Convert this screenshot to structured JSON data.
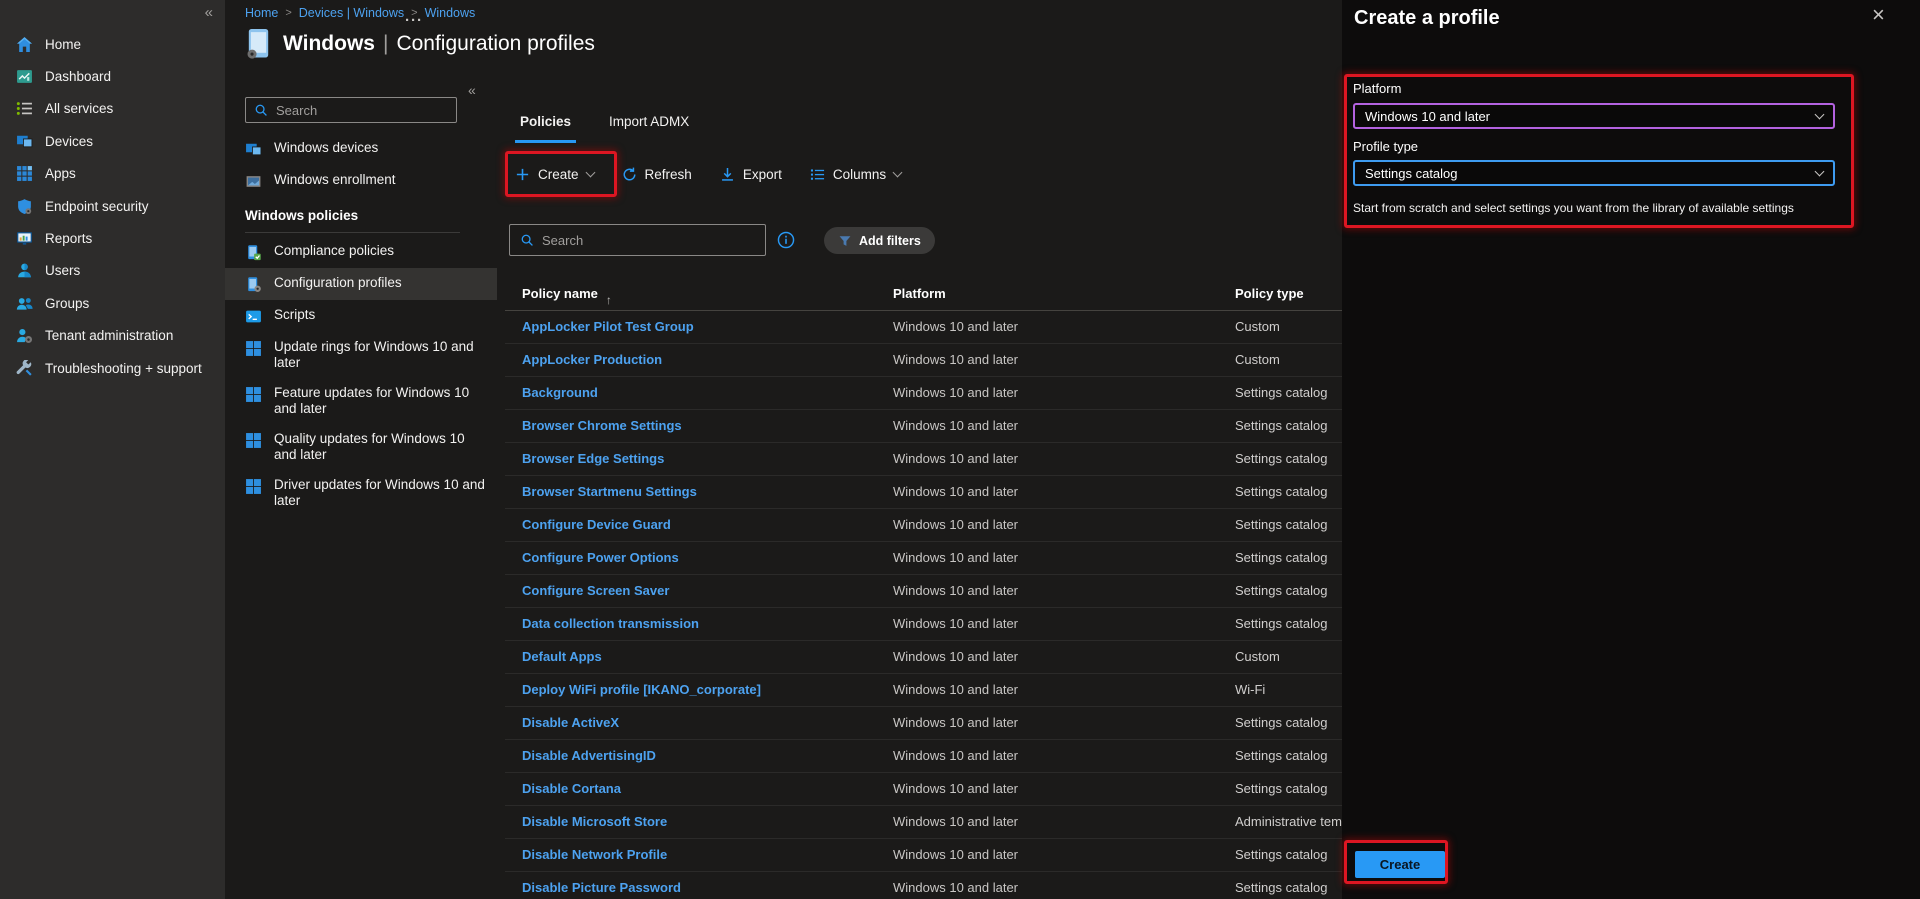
{
  "nav": {
    "collapse_icon": "«",
    "items": [
      {
        "label": "Home",
        "icon": "home"
      },
      {
        "label": "Dashboard",
        "icon": "dashboard"
      },
      {
        "label": "All services",
        "icon": "all-services"
      },
      {
        "label": "Devices",
        "icon": "devices"
      },
      {
        "label": "Apps",
        "icon": "apps"
      },
      {
        "label": "Endpoint security",
        "icon": "endpoint-security"
      },
      {
        "label": "Reports",
        "icon": "reports"
      },
      {
        "label": "Users",
        "icon": "users"
      },
      {
        "label": "Groups",
        "icon": "groups"
      },
      {
        "label": "Tenant administration",
        "icon": "tenant-administration"
      },
      {
        "label": "Troubleshooting + support",
        "icon": "troubleshooting"
      }
    ]
  },
  "breadcrumb": {
    "separator": ">",
    "items": [
      "Home",
      "Devices | Windows",
      "Windows"
    ]
  },
  "page": {
    "title_bold": "Windows",
    "title_divider": "|",
    "title_rest": "Configuration profiles",
    "more_icon": "···"
  },
  "sidebar2": {
    "search_placeholder": "Search",
    "collapse_icon": "«",
    "top_items": [
      {
        "label": "Windows devices",
        "icon": "windows-devices"
      },
      {
        "label": "Windows enrollment",
        "icon": "windows-enrollment"
      }
    ],
    "section_title": "Windows policies",
    "items": [
      {
        "label": "Compliance policies",
        "icon": "compliance-policies",
        "selected": false
      },
      {
        "label": "Configuration profiles",
        "icon": "configuration-profiles",
        "selected": true
      },
      {
        "label": "Scripts",
        "icon": "scripts",
        "selected": false
      },
      {
        "label": "Update rings for Windows 10 and later",
        "icon": "windows-logo",
        "selected": false
      },
      {
        "label": "Feature updates for Windows 10 and later",
        "icon": "windows-logo",
        "selected": false
      },
      {
        "label": "Quality updates for Windows 10 and later",
        "icon": "windows-logo",
        "selected": false
      },
      {
        "label": "Driver updates for Windows 10 and later",
        "icon": "windows-logo",
        "selected": false
      }
    ]
  },
  "tabs": [
    {
      "label": "Policies",
      "selected": true
    },
    {
      "label": "Import ADMX",
      "selected": false
    }
  ],
  "toolbar": {
    "create_label": "Create",
    "refresh_label": "Refresh",
    "export_label": "Export",
    "columns_label": "Columns"
  },
  "filter_bar": {
    "search_placeholder": "Search",
    "add_filters_label": "Add filters"
  },
  "table": {
    "columns": [
      "Policy name",
      "Platform",
      "Policy type"
    ],
    "sort_icon": "↑",
    "rows": [
      [
        "AppLocker Pilot Test Group",
        "Windows 10 and later",
        "Custom"
      ],
      [
        "AppLocker Production",
        "Windows 10 and later",
        "Custom"
      ],
      [
        "Background",
        "Windows 10 and later",
        "Settings catalog"
      ],
      [
        "Browser Chrome Settings",
        "Windows 10 and later",
        "Settings catalog"
      ],
      [
        "Browser Edge Settings",
        "Windows 10 and later",
        "Settings catalog"
      ],
      [
        "Browser Startmenu Settings",
        "Windows 10 and later",
        "Settings catalog"
      ],
      [
        "Configure Device Guard",
        "Windows 10 and later",
        "Settings catalog"
      ],
      [
        "Configure Power Options",
        "Windows 10 and later",
        "Settings catalog"
      ],
      [
        "Configure Screen Saver",
        "Windows 10 and later",
        "Settings catalog"
      ],
      [
        "Data collection transmission",
        "Windows 10 and later",
        "Settings catalog"
      ],
      [
        "Default Apps",
        "Windows 10 and later",
        "Custom"
      ],
      [
        "Deploy WiFi profile [IKANO_corporate]",
        "Windows 10 and later",
        "Wi-Fi"
      ],
      [
        "Disable ActiveX",
        "Windows 10 and later",
        "Settings catalog"
      ],
      [
        "Disable AdvertisingID",
        "Windows 10 and later",
        "Settings catalog"
      ],
      [
        "Disable Cortana",
        "Windows 10 and later",
        "Settings catalog"
      ],
      [
        "Disable Microsoft Store",
        "Windows 10 and later",
        "Administrative templates"
      ],
      [
        "Disable Network Profile",
        "Windows 10 and later",
        "Settings catalog"
      ],
      [
        "Disable Picture Password",
        "Windows 10 and later",
        "Settings catalog"
      ]
    ]
  },
  "panel": {
    "title": "Create a profile",
    "close_icon": "×",
    "platform_label": "Platform",
    "platform_value": "Windows 10 and later",
    "profile_type_label": "Profile type",
    "profile_type_value": "Settings catalog",
    "description": "Start from scratch and select settings you want from the library of available settings",
    "create_label": "Create"
  },
  "colors": {
    "accent": "#2899f5",
    "link": "#4da2f0",
    "annotation_red": "#dd1622",
    "platform_dropdown_border": "#b362e0",
    "profile_dropdown_border": "#3e9bf0"
  }
}
